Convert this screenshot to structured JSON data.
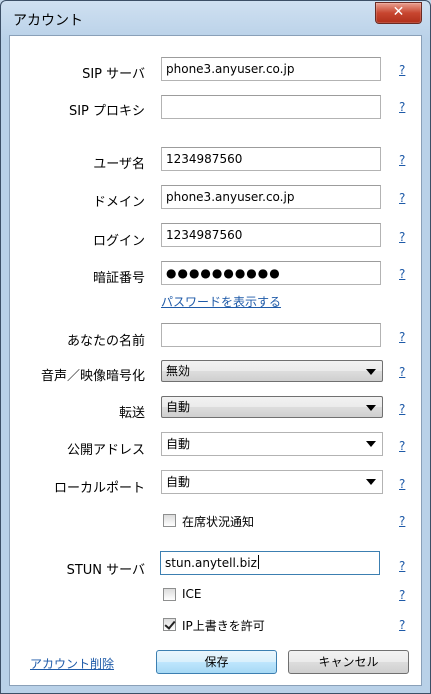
{
  "window": {
    "title": "アカウント",
    "close_glyph": "✕"
  },
  "fields": {
    "sip_server": {
      "label": "SIP サーバ",
      "value": "phone3.anyuser.co.jp"
    },
    "sip_proxy": {
      "label": "SIP プロキシ",
      "value": ""
    },
    "username": {
      "label": "ユーザ名",
      "value": "1234987560"
    },
    "domain": {
      "label": "ドメイン",
      "value": "phone3.anyuser.co.jp"
    },
    "login": {
      "label": "ログイン",
      "value": "1234987560"
    },
    "password": {
      "label": "暗証番号",
      "value": "●●●●●●●●●●"
    },
    "show_password_link": "パスワードを表示する",
    "your_name": {
      "label": "あなたの名前",
      "value": ""
    },
    "encryption": {
      "label": "音声／映像暗号化",
      "value": "無効"
    },
    "transport": {
      "label": "転送",
      "value": "自動"
    },
    "public_address": {
      "label": "公開アドレス",
      "value": "自動"
    },
    "local_port": {
      "label": "ローカルポート",
      "value": "自動"
    },
    "presence": {
      "label": "在席状況通知",
      "checked": false
    },
    "stun_server": {
      "label": "STUN サーバ",
      "value": "stun.anytell.biz"
    },
    "ice": {
      "label": "ICE",
      "checked": false
    },
    "ip_rewrite": {
      "label": "IP上書きを許可",
      "checked": true
    }
  },
  "help_label": "?",
  "footer": {
    "delete_link": "アカウント削除",
    "save_label": "保存",
    "cancel_label": "キャンセル"
  }
}
